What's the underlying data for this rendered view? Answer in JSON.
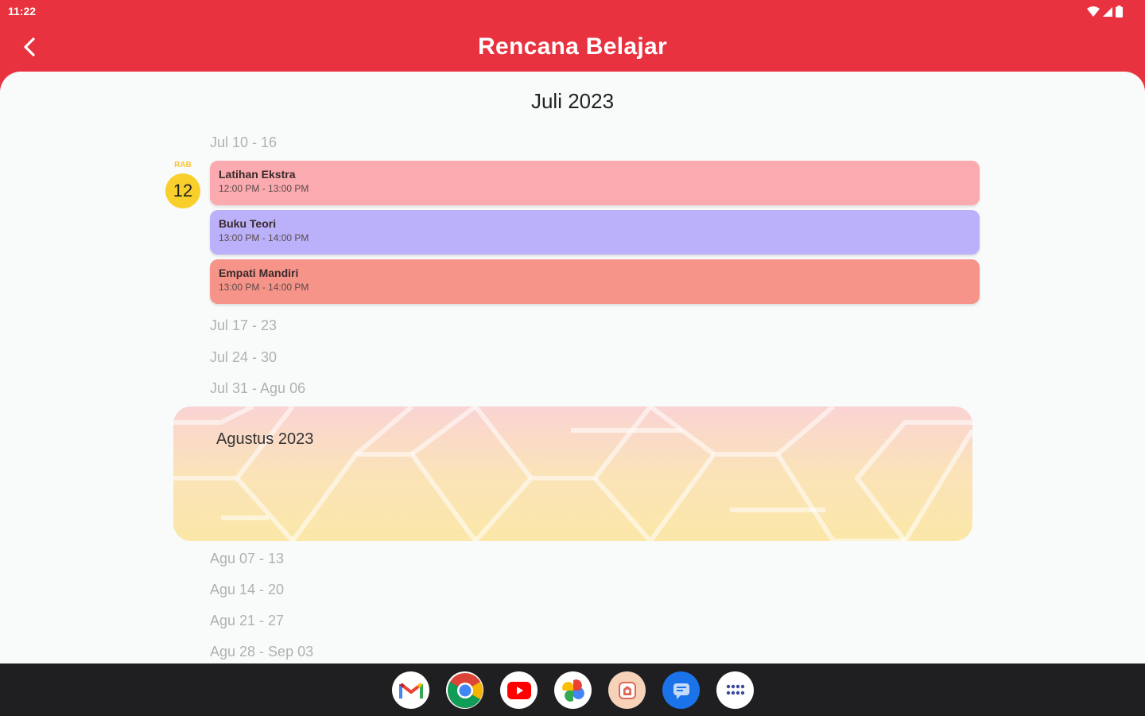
{
  "status_bar": {
    "time": "11:22"
  },
  "app_bar": {
    "title": "Rencana Belajar"
  },
  "calendar": {
    "month_title": "Juli 2023",
    "weeks_july": [
      "Jul 10 - 16",
      "Jul 17 - 23",
      "Jul 24 - 30",
      "Jul 31 - Agu 06"
    ],
    "selected_day": {
      "abbr": "RAB",
      "number": "12"
    },
    "events": [
      {
        "title": "Latihan Ekstra",
        "time": "12:00 PM - 13:00 PM",
        "color": "#fbaaaf"
      },
      {
        "title": "Buku Teori",
        "time": "13:00 PM - 14:00 PM",
        "color": "#bbb1fb"
      },
      {
        "title": "Empati Mandiri",
        "time": "13:00 PM - 14:00 PM",
        "color": "#f7948a"
      }
    ],
    "next_month_title": "Agustus 2023",
    "weeks_august": [
      "Agu 07 - 13",
      "Agu 14 - 20",
      "Agu 21 - 27",
      "Agu 28 - Sep 03"
    ]
  },
  "colors": {
    "primary": "#e8323f",
    "today": "#f9cf2c",
    "background": "#f9fbfb"
  },
  "dock": {
    "apps": [
      "gmail-icon",
      "chrome-icon",
      "youtube-icon",
      "photos-icon",
      "app-icon",
      "messages-icon",
      "app-drawer-icon"
    ]
  }
}
